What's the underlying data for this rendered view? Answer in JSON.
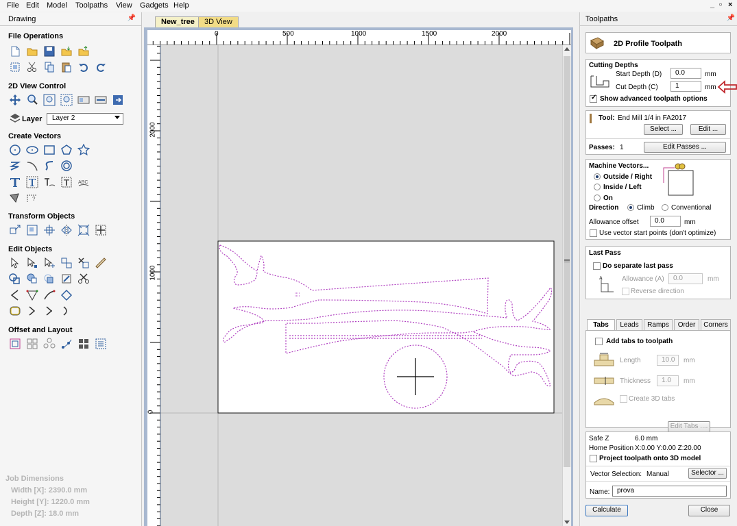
{
  "menu": [
    "File",
    "Edit",
    "Model",
    "Toolpaths",
    "View",
    "Gadgets",
    "Help"
  ],
  "window_controls": [
    "_",
    "▫",
    "×"
  ],
  "left": {
    "title": "Drawing",
    "sections": {
      "file_ops": "File Operations",
      "view2d": "2D View Control",
      "create": "Create Vectors",
      "transform": "Transform Objects",
      "edit": "Edit Objects",
      "offset": "Offset and Layout"
    },
    "layer_label": "Layer",
    "layer_value": "Layer 2",
    "job": {
      "title": "Job Dimensions",
      "width": "Width  [X]: 2390.0 mm",
      "height": "Height [Y]: 1220.0 mm",
      "depth": "Depth  [Z]: 18.0 mm"
    }
  },
  "tabs": [
    "New_tree",
    "3D View"
  ],
  "ruler": {
    "top": [
      "0",
      "500",
      "1000",
      "1500",
      "2000"
    ],
    "left": [
      "2000",
      "1000",
      "0"
    ]
  },
  "right": {
    "title": "Toolpaths",
    "header": "2D Profile Toolpath",
    "cutting_depths": {
      "title": "Cutting Depths",
      "start_label": "Start Depth (D)",
      "start_value": "0.0",
      "cut_label": "Cut Depth (C)",
      "cut_value": "1",
      "unit": "mm",
      "advanced_label": "Show advanced toolpath options"
    },
    "tool": {
      "label": "Tool:",
      "value": "End Mill 1/4 in FA2017",
      "select": "Select ...",
      "edit": "Edit ...",
      "passes_label": "Passes:",
      "passes_value": "1",
      "edit_passes": "Edit Passes ..."
    },
    "machine": {
      "title": "Machine Vectors...",
      "outside": "Outside / Right",
      "inside": "Inside / Left",
      "on": "On",
      "direction": "Direction",
      "climb": "Climb",
      "conventional": "Conventional",
      "allowance_label": "Allowance offset",
      "allowance_value": "0.0",
      "unit": "mm",
      "start_points": "Use vector start points (don't optimize)"
    },
    "last_pass": {
      "title": "Last Pass",
      "separate": "Do separate last pass",
      "allowance_label": "Allowance (A)",
      "allowance_value": "0.0",
      "unit": "mm",
      "reverse": "Reverse direction"
    },
    "subtabs": [
      "Tabs",
      "Leads",
      "Ramps",
      "Order",
      "Corners"
    ],
    "tabs_panel": {
      "add": "Add tabs to toolpath",
      "length_label": "Length",
      "length_value": "10.0",
      "thickness_label": "Thickness",
      "thickness_value": "1.0",
      "unit": "mm",
      "create3d": "Create 3D tabs",
      "edit_tabs": "Edit Tabs ...."
    },
    "footer": {
      "safe_z_label": "Safe Z",
      "safe_z_value": "6.0 mm",
      "home_label": "Home Position",
      "home_value": "X:0.00 Y:0.00 Z:20.00",
      "project": "Project toolpath onto 3D model",
      "vector_sel_label": "Vector Selection:",
      "vector_sel_value": "Manual",
      "selector": "Selector ...",
      "name_label": "Name:",
      "name_value": "prova",
      "calculate": "Calculate",
      "close": "Close"
    }
  },
  "colors": {
    "vector": "#b040c0",
    "accent_arrow": "#c0262c",
    "icon_blue": "#2f5f9f"
  }
}
